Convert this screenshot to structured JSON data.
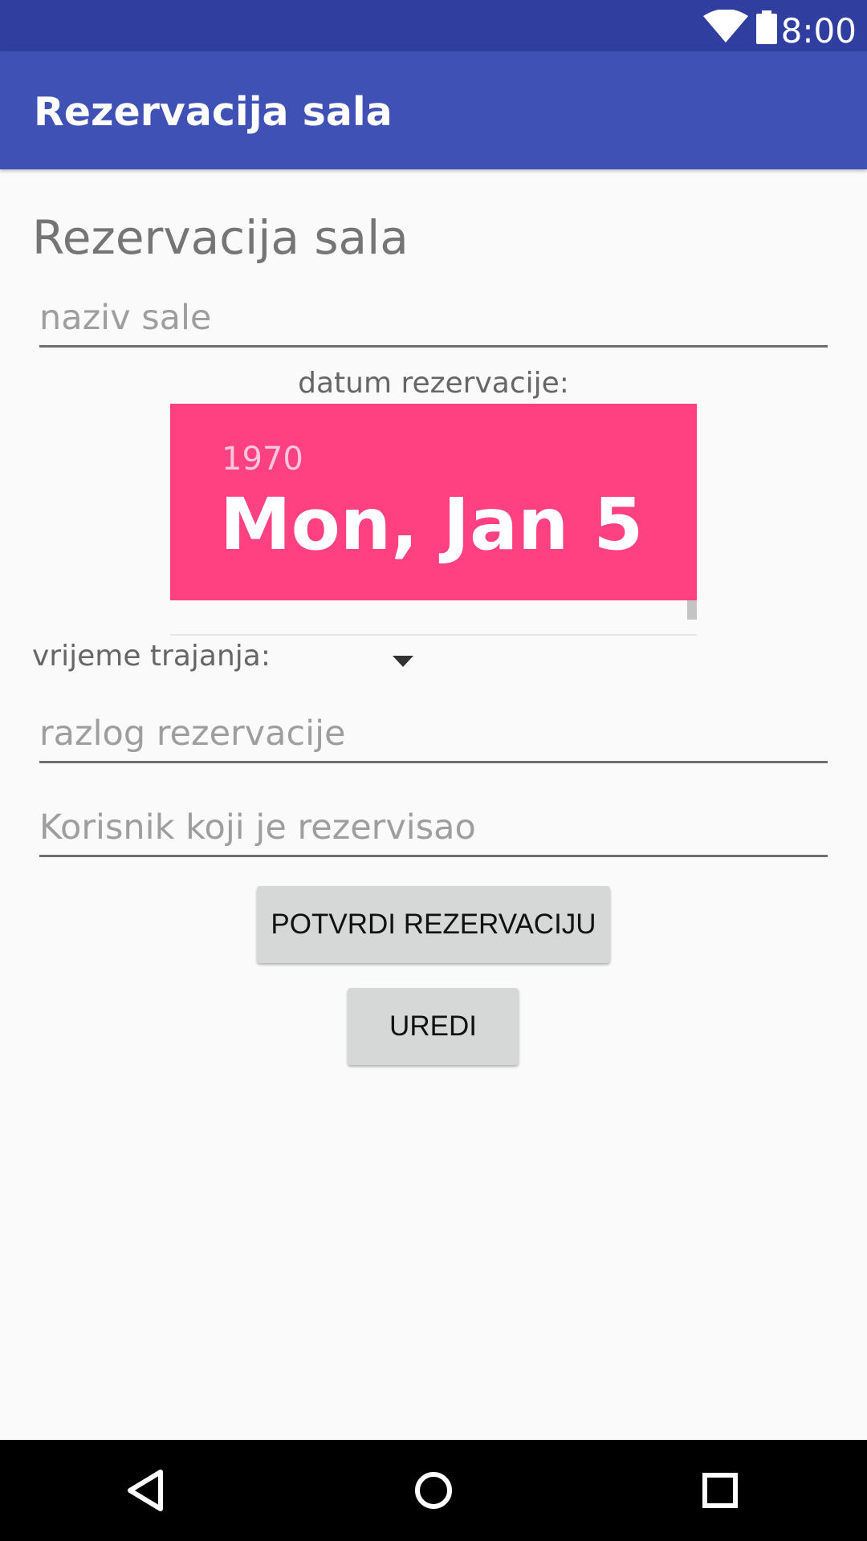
{
  "status_bar": {
    "time": "8:00",
    "icons": [
      "wifi-icon",
      "battery-icon"
    ]
  },
  "app_bar": {
    "title": "Rezervacija sala"
  },
  "form": {
    "heading": "Rezervacija sala",
    "room_name_placeholder": "naziv sale",
    "date_label": "datum rezervacije:",
    "date_picker": {
      "year": "1970",
      "date": "Mon, Jan 5"
    },
    "duration_label": "vrijeme trajanja:",
    "duration_value": "",
    "reason_placeholder": "razlog rezervacije",
    "user_placeholder": "Korisnik koji je rezervisao",
    "confirm_button": "POTVRDI REZERVACIJU",
    "edit_button": "UREDI"
  },
  "nav_bar": {
    "icons": [
      "back-icon",
      "home-icon",
      "recents-icon"
    ]
  },
  "colors": {
    "status_bar": "#303f9f",
    "app_bar": "#3f51b5",
    "accent": "#ff4081",
    "button": "#d6d7d7",
    "background": "#fafafa"
  }
}
